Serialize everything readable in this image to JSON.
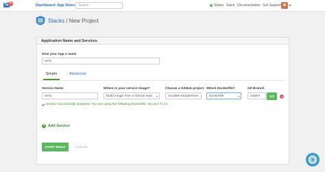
{
  "topbar": {
    "mail_badge": "6",
    "nav": [
      "Dashboard",
      "App Store"
    ],
    "search_placeholder": "Search",
    "status_label": "Status",
    "links": [
      "Slack",
      "Documentation",
      "Get Support"
    ],
    "status_color": "#5cb85c"
  },
  "header": {
    "breadcrumb": "Stacks",
    "separator": "/",
    "title": "New Project"
  },
  "panel": {
    "heading": "Application Name and Services",
    "app_name_label": "Give your App a name",
    "app_name_value": "vertx",
    "tabs": [
      "Simple",
      "Advanced"
    ],
    "columns": {
      "service_name": "Service Name",
      "image_source": "Where is your service image?",
      "github_project": "Choose a GitHub project",
      "dockerfile": "Which Dockerfile?",
      "git_branch": "Git Branch"
    },
    "row": {
      "service_name": "vertx",
      "image_source": "Build image from a GitHub repo",
      "github_project": "cloud66-samples/ver...",
      "dockerfile": "Dockerfile",
      "git_branch": "master",
      "go_label": "GO"
    },
    "success_text": "Service successfully analyzed. You are using the following Dockerfile:",
    "success_file": "Dockerfile",
    "add_service": "Add Service",
    "start_build": "START BUILD",
    "cancel": "CANCEL"
  },
  "colors": {
    "accent_green": "#5cb85c",
    "link_blue": "#2a6db4",
    "remove_red": "#d9534f"
  }
}
